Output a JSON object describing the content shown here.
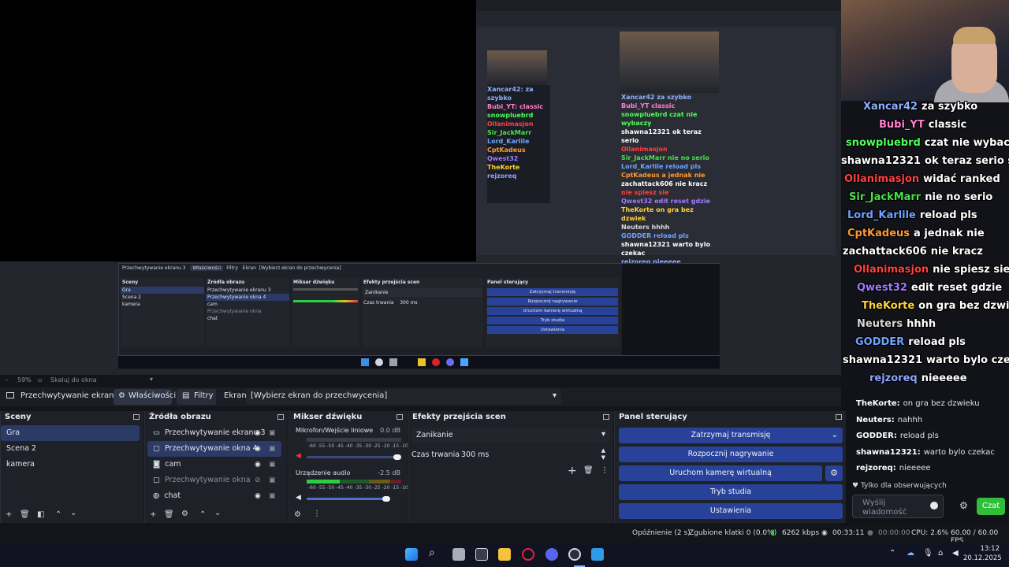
{
  "preview": {
    "zoom": "59%",
    "scale_label": "Skaluj do okna",
    "nested_titles": {
      "source": "Przechwytywanie ekranu 3",
      "props": "Właściwości",
      "filters": "Filtry",
      "screen": "Ekran",
      "screen_value": "[Wybierz ekran do przechwycenia]"
    }
  },
  "toolbar": {
    "source_name": "Przechwytywanie ekranu 3",
    "properties_label": "Właściwości",
    "filters_label": "Filtry",
    "screen_label": "Ekran",
    "screen_value": "[Wybierz ekran do przechwycenia]"
  },
  "scenes": {
    "title": "Sceny",
    "items": [
      "Gra",
      "Scena 2",
      "kamera"
    ]
  },
  "sources": {
    "title": "Źródła obrazu",
    "items": [
      {
        "label": "Przechwytywanie ekranu 3",
        "icon": "monitor-icon"
      },
      {
        "label": "Przechwytywanie okna 4",
        "icon": "window-icon"
      },
      {
        "label": "cam",
        "icon": "camera-icon"
      },
      {
        "label": "Przechwytywanie okna",
        "icon": "window-icon"
      },
      {
        "label": "chat",
        "icon": "globe-icon"
      }
    ]
  },
  "mixer": {
    "title": "Mikser dźwięku",
    "channels": [
      {
        "name": "Mikrofon/Wejście liniowe",
        "db": "0.0 dB",
        "level": 0.0
      },
      {
        "name": "Urządzenie audio",
        "db": "-2.5 dB",
        "level": 0.35
      }
    ],
    "scale": "-60 -55 -50 -45 -40 -35 -30 -25 -20 -15 -10 -5 0"
  },
  "transitions": {
    "title": "Efekty przejścia scen",
    "selected": "Zanikanie",
    "duration_label": "Czas trwania",
    "duration_value": "300 ms"
  },
  "controls": {
    "title": "Panel sterujący",
    "buttons": [
      "Zatrzymaj transmisję",
      "Rozpocznij nagrywanie",
      "Uruchom kamerę wirtualną",
      "Tryb studia",
      "Ustawienia"
    ]
  },
  "status": {
    "delay": "Opóźnienie (2 s)",
    "dropped": "Zgubione klatki 0 (0.0%)",
    "bitrate": "6262 kbps",
    "stream_time": "00:33:11",
    "rec_time": "00:00:00",
    "cpu": "CPU: 2.6%",
    "fps": "60.00 / 60.00 FPS"
  },
  "chat": {
    "overlay": [
      {
        "user": "Xancar42",
        "msg": "za szybko",
        "color": "#8fb0ff"
      },
      {
        "user": "Bubi_YT",
        "msg": "classic",
        "color": "#ff7fd1"
      },
      {
        "user": "snowpluebrd",
        "msg": "czat nie wybaczy",
        "color": "#4cff5a"
      },
      {
        "user": "shawna12321",
        "msg": "ok teraz serio sku",
        "color": "#ffffff"
      },
      {
        "user": "Ollanimasjon",
        "msg": "widać ranked",
        "color": "#ff4040"
      },
      {
        "user": "Sir_JackMarr",
        "msg": "nie no serio",
        "color": "#49e04a"
      },
      {
        "user": "Lord_Karlile",
        "msg": "reload pls",
        "color": "#6ea4ff"
      },
      {
        "user": "CptKadeus",
        "msg": "a jednak nie",
        "color": "#ff9a33"
      },
      {
        "user": "zachattack606",
        "msg": "nie kracz",
        "color": "#ffffff"
      },
      {
        "user": "Ollanimasjon",
        "msg": "nie spiesz sie",
        "color": "#ff4040"
      },
      {
        "user": "Qwest32",
        "msg": "edit reset gdzie",
        "color": "#a07bff"
      },
      {
        "user": "TheKorte",
        "msg": "on gra bez dzwiek",
        "color": "#ffd23a"
      },
      {
        "user": "Neuters",
        "msg": "hhhh",
        "color": "#d8d8d8"
      },
      {
        "user": "GODDER",
        "msg": "reload pls",
        "color": "#6ea4ff"
      },
      {
        "user": "shawna12321",
        "msg": "warto bylo czekac",
        "color": "#ffffff"
      },
      {
        "user": "rejzoreq",
        "msg": "nieeeee",
        "color": "#8fa4ff"
      }
    ],
    "lines": [
      {
        "user": "TheKorte:",
        "msg": "on gra bez dzwieku"
      },
      {
        "user": "Neuters:",
        "msg": "nahhh"
      },
      {
        "user": "GODDER:",
        "msg": "reload pls"
      },
      {
        "user": "shawna12321:",
        "msg": "warto bylo czekac"
      },
      {
        "user": "rejzoreq:",
        "msg": "nieeeee"
      }
    ],
    "followers_only": "Tylko dla obserwujących",
    "input_placeholder": "Wyślij wiadomość",
    "send_label": "Czat"
  },
  "clock": {
    "time": "13:12",
    "date": "20.12.2025"
  }
}
